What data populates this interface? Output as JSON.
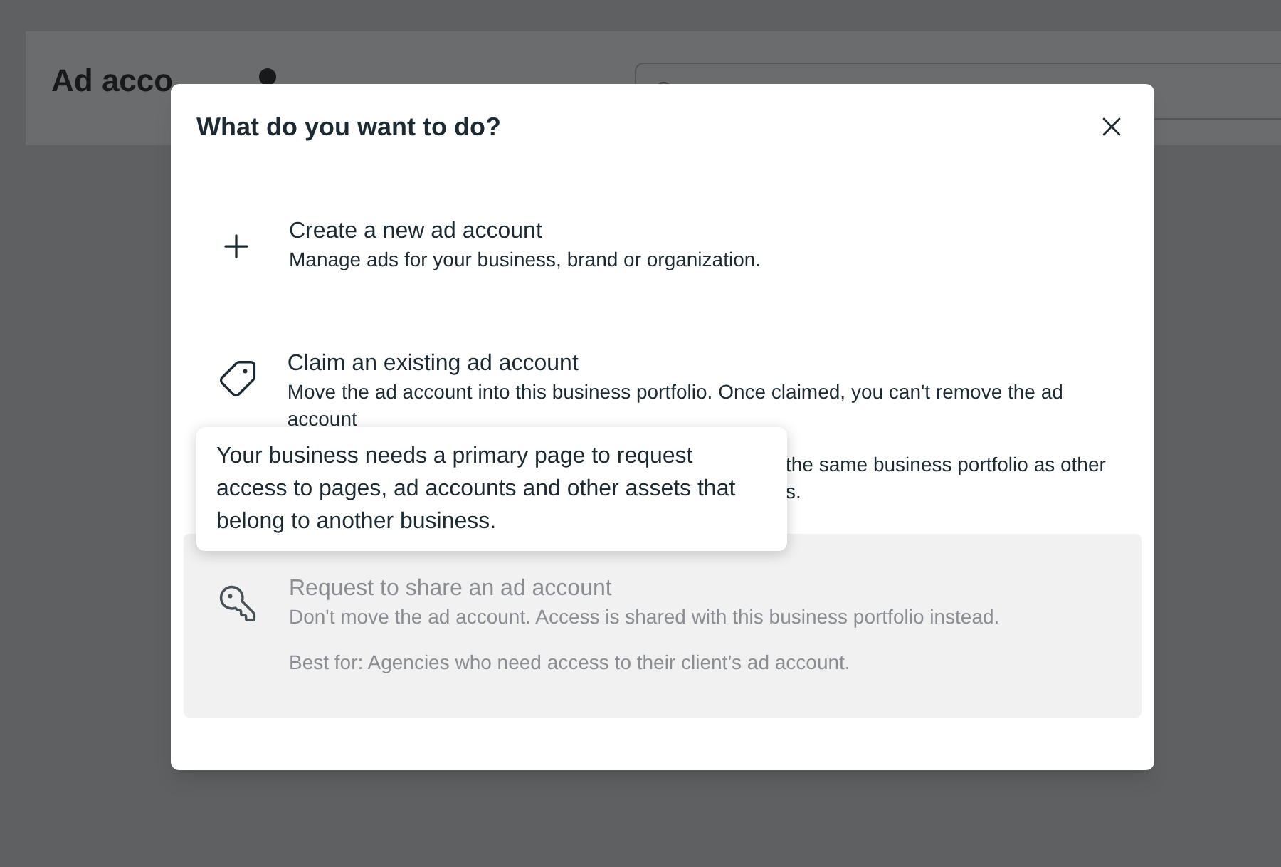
{
  "background": {
    "title": "Ad acco"
  },
  "dialog": {
    "title": "What do you want to do?"
  },
  "options": [
    {
      "kind": "create",
      "title": "Create a new ad account",
      "lines": [
        "Manage ads for your business, brand or organization."
      ]
    },
    {
      "kind": "claim",
      "title": "Claim an existing ad account",
      "lines": [
        "Move the ad account into this business portfolio. Once claimed, you can't remove the ad account"
      ]
    },
    {
      "kind": "covered",
      "lines": [
        "the same business portfolio as other",
        "s."
      ]
    },
    {
      "kind": "share",
      "title": "Request to share an ad account",
      "lines": [
        "Don't move the ad account. Access is shared with this business portfolio instead."
      ],
      "note": "Best for: Agencies who need access to their client’s ad account.",
      "disabled": true
    }
  ],
  "tooltip": {
    "text": "Your business needs a primary page to request access to pages, ad accounts and other assets that belong to another business."
  }
}
